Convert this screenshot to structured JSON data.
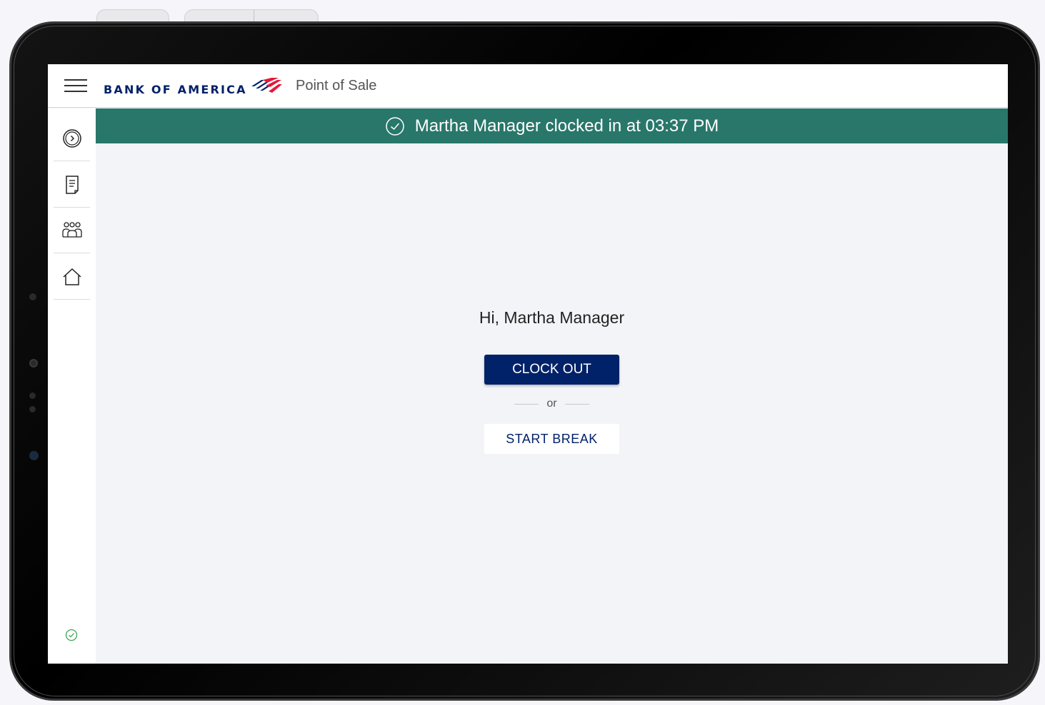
{
  "header": {
    "brand": "BANK OF AMERICA",
    "app_title": "Point of Sale"
  },
  "sidebar": {
    "items": [
      {
        "icon": "clock-forward-icon"
      },
      {
        "icon": "receipt-icon"
      },
      {
        "icon": "people-icon"
      },
      {
        "icon": "home-icon"
      }
    ],
    "status_icon": "check-circle-icon"
  },
  "banner": {
    "message": "Martha Manager clocked in at 03:37 PM",
    "icon": "check-circle-icon"
  },
  "main": {
    "greeting": "Hi, Martha Manager",
    "clock_out_label": "CLOCK OUT",
    "separator": "or",
    "start_break_label": "START BREAK"
  },
  "colors": {
    "brand_blue": "#012169",
    "brand_red": "#e31837",
    "banner_green": "#28776a",
    "status_green": "#3aa655"
  }
}
